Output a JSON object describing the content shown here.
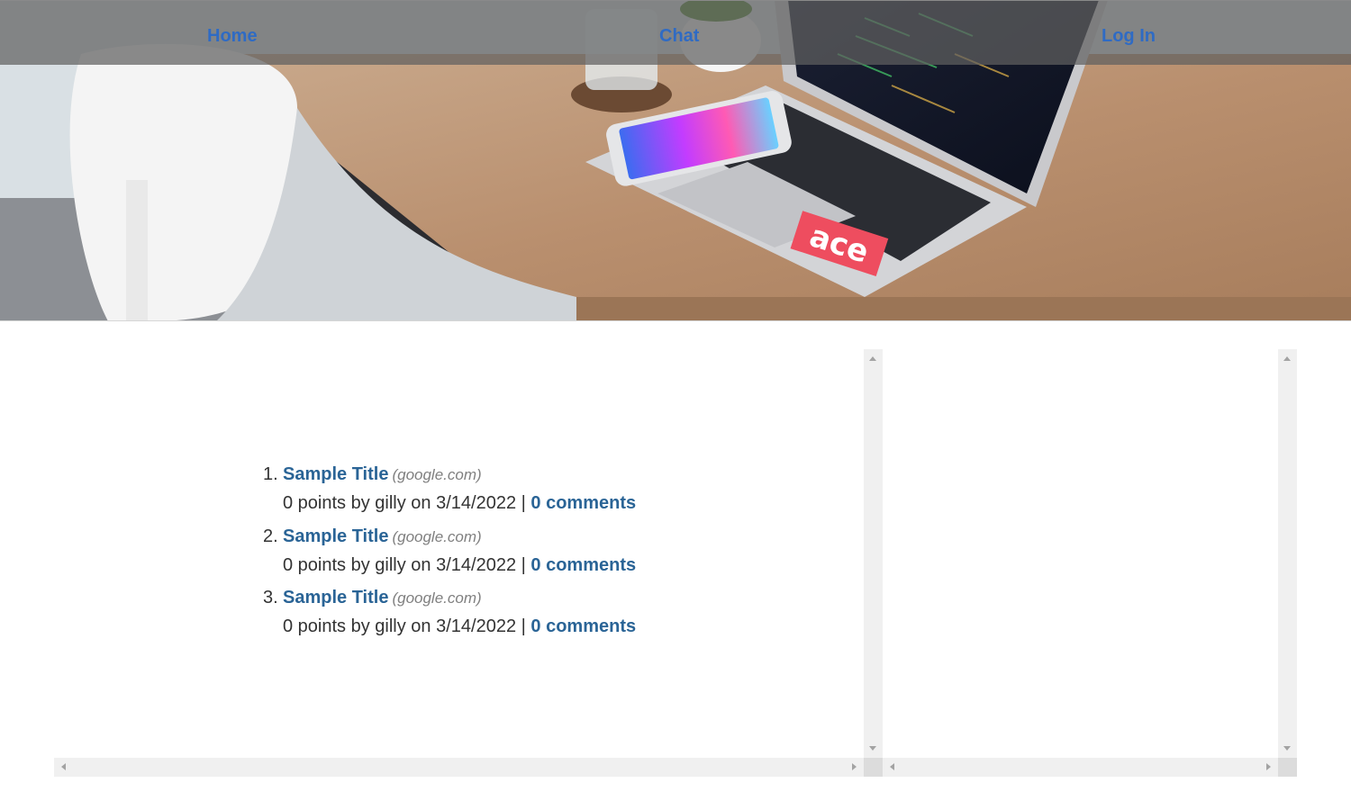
{
  "nav": {
    "home_label": "Home",
    "chat_label": "Chat",
    "login_label": "Log In"
  },
  "hero": {
    "sticker_text": "ace"
  },
  "stories": [
    {
      "number": "1.",
      "title": "Sample Title",
      "domain": "(google.com)",
      "meta": "0 points by gilly on 3/14/2022 | ",
      "comments": "0 comments"
    },
    {
      "number": "2.",
      "title": "Sample Title",
      "domain": "(google.com)",
      "meta": "0 points by gilly on 3/14/2022 | ",
      "comments": "0 comments"
    },
    {
      "number": "3.",
      "title": "Sample Title",
      "domain": "(google.com)",
      "meta": "0 points by gilly on 3/14/2022 | ",
      "comments": "0 comments"
    }
  ],
  "colors": {
    "link": "#2a6496",
    "nav_link": "#2f6bc4",
    "nav_bar": "#5f5f5f",
    "scrollbar": "#f0f0f0"
  }
}
